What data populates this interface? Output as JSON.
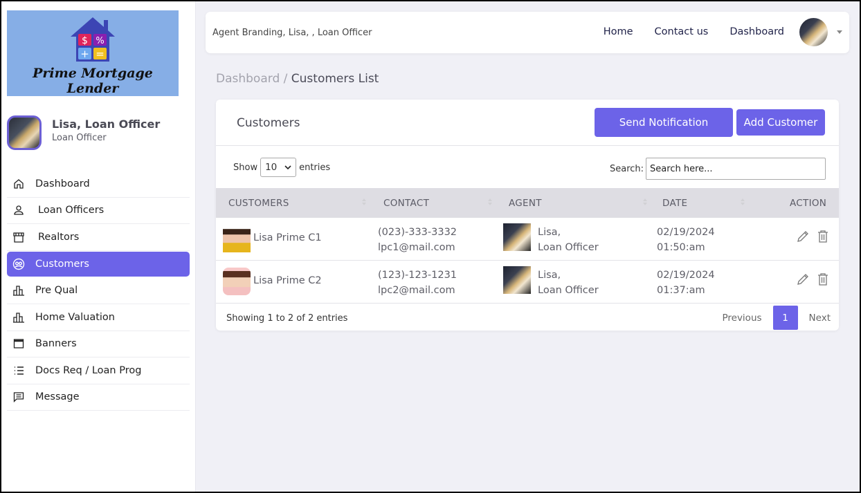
{
  "app": {
    "logo_text": "Prime Mortgage Lender",
    "accent_color": "#6c63e8"
  },
  "profile": {
    "name": "Lisa, Loan Officer",
    "role": "Loan Officer"
  },
  "sidebar": {
    "items": [
      {
        "label": "Dashboard",
        "icon": "home-icon"
      },
      {
        "label": "Loan Officers",
        "icon": "user-icon"
      },
      {
        "label": "Realtors",
        "icon": "store-icon"
      },
      {
        "label": "Customers",
        "icon": "customers-icon",
        "active": true
      },
      {
        "label": "Pre Qual",
        "icon": "bar-chart-icon"
      },
      {
        "label": "Home Valuation",
        "icon": "bar-chart-icon"
      },
      {
        "label": "Banners",
        "icon": "window-icon"
      },
      {
        "label": "Docs Req / Loan Prog",
        "icon": "list-icon"
      },
      {
        "label": "Message",
        "icon": "message-icon"
      }
    ]
  },
  "topbar": {
    "brand": "Agent Branding, Lisa, , Loan Officer",
    "links": [
      "Home",
      "Contact us",
      "Dashboard"
    ]
  },
  "breadcrumb": {
    "parent": "Dashboard",
    "separator": " / ",
    "current": "Customers List"
  },
  "card": {
    "title": "Customers",
    "send_notification_label": "Send Notification",
    "add_customer_label": "Add Customer",
    "show_label": "Show",
    "entries_label": "entries",
    "page_size": "10",
    "search_label": "Search:",
    "search_placeholder": "Search here..."
  },
  "table": {
    "columns": [
      "CUSTOMERS",
      "CONTACT",
      "AGENT",
      "DATE",
      "ACTION"
    ],
    "rows": [
      {
        "customer": "Lisa Prime C1",
        "phone": "(023)-333-3332",
        "email": "lpc1@mail.com",
        "agent_name": "Lisa,",
        "agent_role": "Loan Officer",
        "date": "02/19/2024",
        "time": "01:50:am"
      },
      {
        "customer": "Lisa Prime C2",
        "phone": "(123)-123-1231",
        "email": "lpc2@mail.com",
        "agent_name": "Lisa,",
        "agent_role": "Loan Officer",
        "date": "02/19/2024",
        "time": "01:37:am"
      }
    ]
  },
  "footer": {
    "info": "Showing 1 to 2 of 2 entries",
    "previous_label": "Previous",
    "current_page": "1",
    "next_label": "Next"
  }
}
